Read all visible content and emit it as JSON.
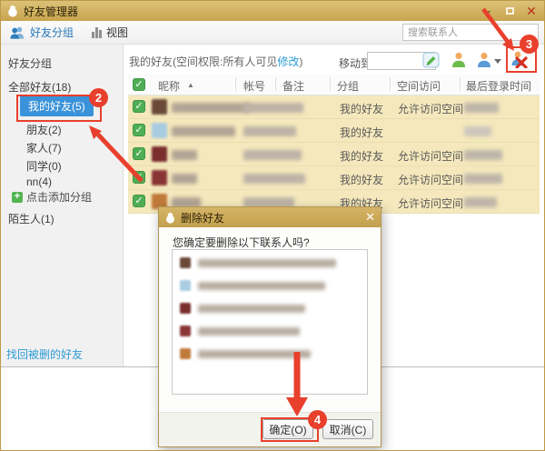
{
  "titlebar": {
    "title": "好友管理器"
  },
  "toolbar": {
    "group_tab": "好友分组",
    "view_tab": "视图",
    "search_placeholder": "搜索联系人"
  },
  "sidebar": {
    "header": "好友分组",
    "items": [
      {
        "label": "全部好友(18)",
        "selected": false
      },
      {
        "label": "我的好友(5)",
        "selected": true
      },
      {
        "label": "朋友(2)",
        "selected": false
      },
      {
        "label": "家人(7)",
        "selected": false
      },
      {
        "label": "同学(0)",
        "selected": false
      },
      {
        "label": "nn(4)",
        "selected": false
      }
    ],
    "add_group_label": "点击添加分组",
    "stranger_label": "陌生人(1)",
    "recover_link": "找回被删的好友"
  },
  "main": {
    "caption_prefix": "我的好友(空间权限:所有人可见",
    "caption_link": "修改",
    "caption_suffix": ")",
    "move_to_label": "移动到",
    "table": {
      "headers": [
        "昵称",
        "帐号",
        "备注",
        "分组",
        "空间访问",
        "最后登录时间"
      ],
      "rows": [
        {
          "group": "我的好友",
          "access": "允许访问空间"
        },
        {
          "group": "我的好友",
          "access": ""
        },
        {
          "group": "我的好友",
          "access": "允许访问空间"
        },
        {
          "group": "我的好友",
          "access": "允许访问空间"
        },
        {
          "group": "我的好友",
          "access": "允许访问空间"
        }
      ]
    }
  },
  "dialog": {
    "title": "删除好友",
    "message": "您确定要删除以下联系人吗?",
    "confirm_label": "确定(O)",
    "cancel_label": "取消(C)"
  },
  "annotations": {
    "badge_sidebar": "2",
    "badge_delete_icon": "3",
    "badge_confirm": "4"
  },
  "colors": {
    "title_gold": "#cda956",
    "annotation_red": "#e8402c",
    "selected_blue": "#3a92d9",
    "row_highlight": "#f4e8bc",
    "check_green": "#4fae55",
    "link_blue": "#2e9bd6"
  }
}
